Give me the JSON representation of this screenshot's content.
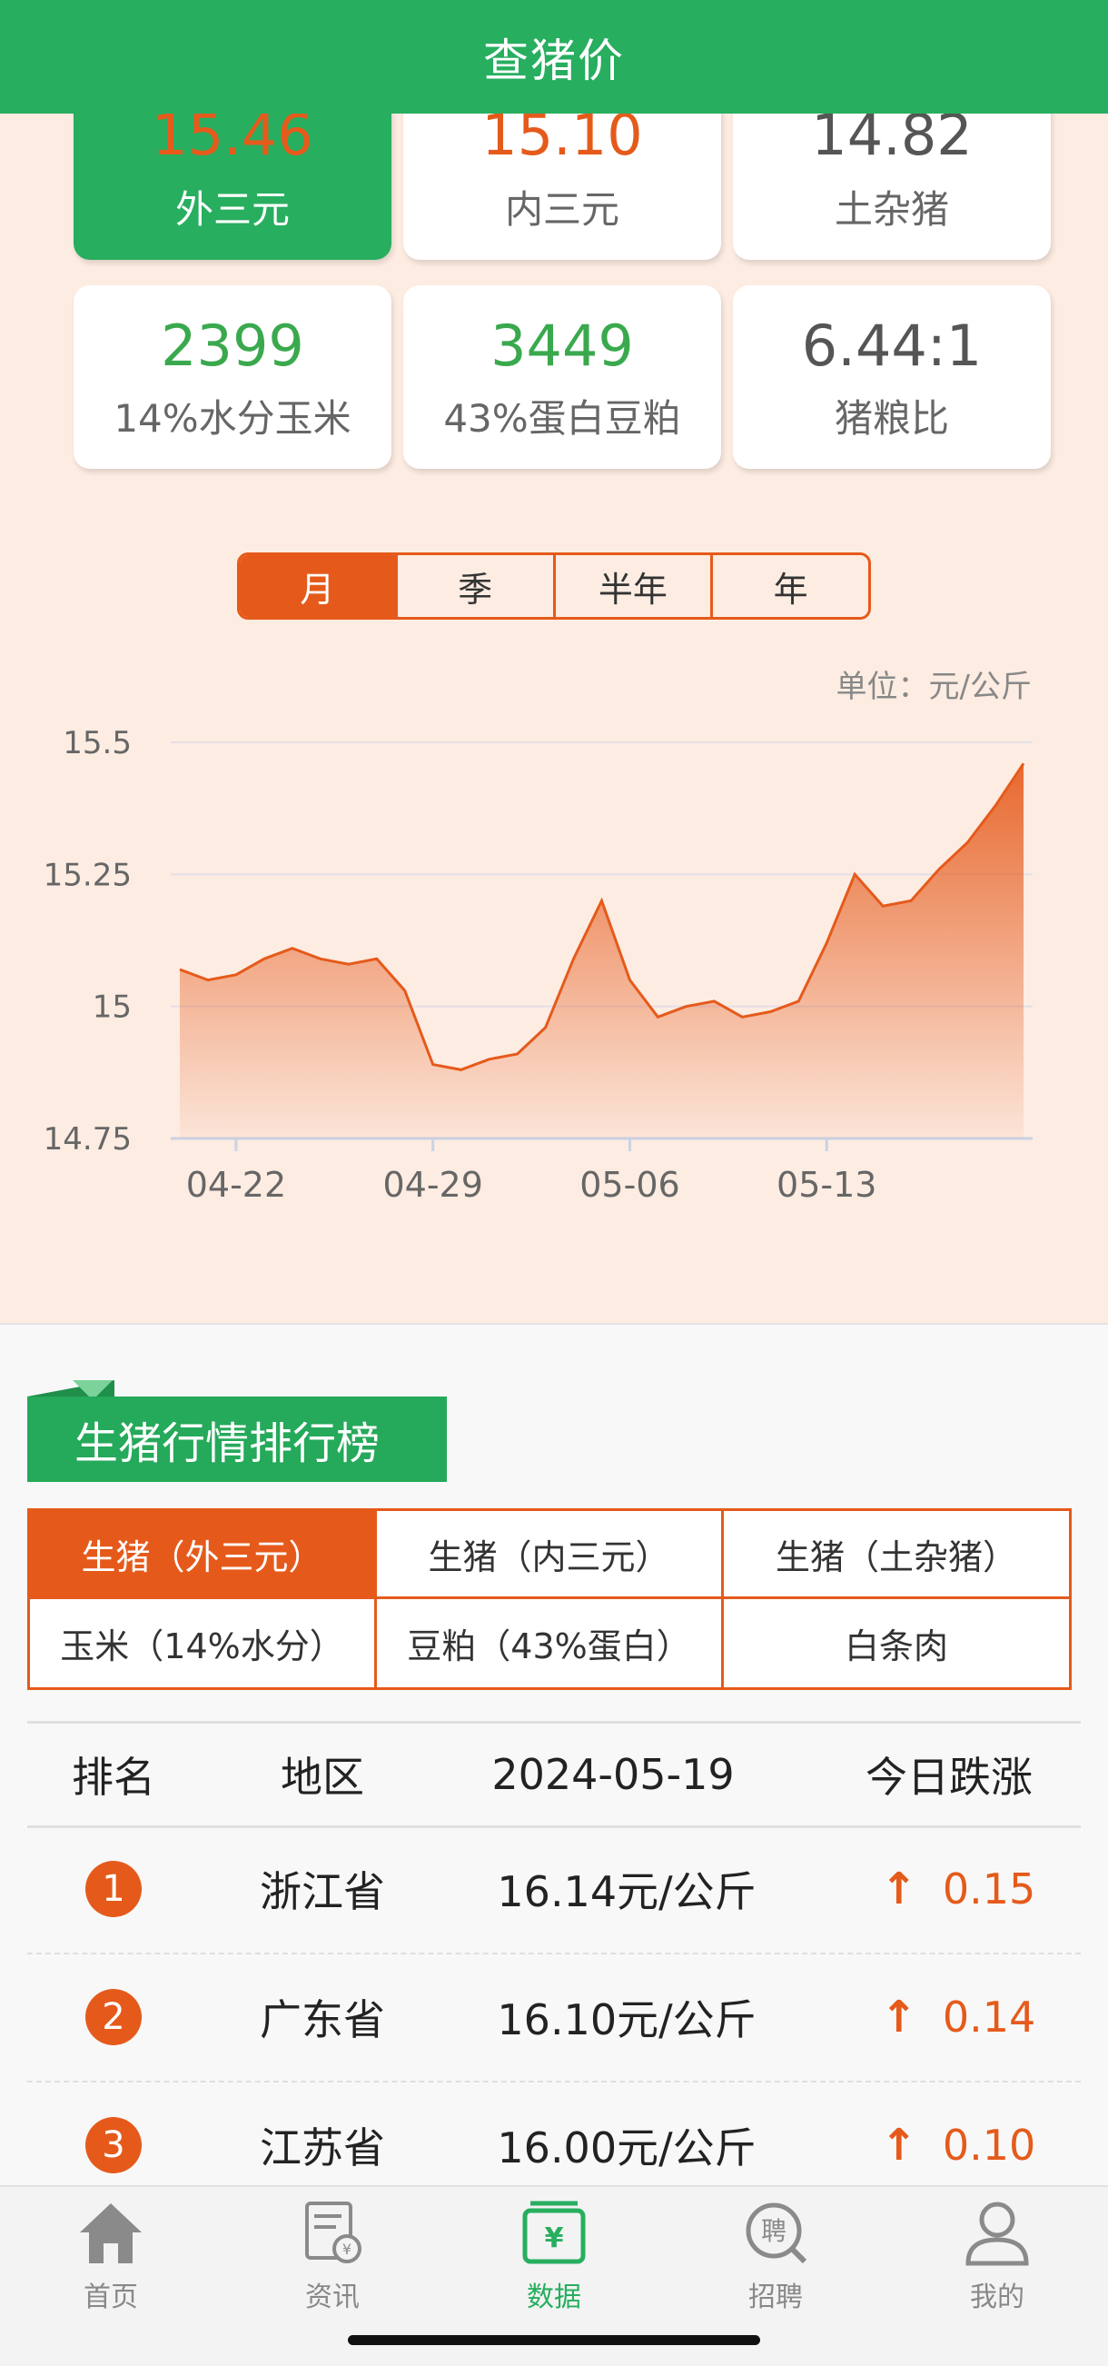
{
  "header": {
    "title": "查猪价"
  },
  "cards": [
    {
      "value": "15.46",
      "label": "外三元",
      "color": "#e55a1b",
      "active": true
    },
    {
      "value": "15.10",
      "label": "内三元",
      "color": "#e55a1b",
      "active": false
    },
    {
      "value": "14.82",
      "label": "土杂猪",
      "color": "#555555",
      "active": false
    },
    {
      "value": "2399",
      "label": "14%水分玉米",
      "color": "#3aa94e",
      "active": false
    },
    {
      "value": "3449",
      "label": "43%蛋白豆粕",
      "color": "#3aa94e",
      "active": false
    },
    {
      "value": "6.44:1",
      "label": "猪粮比",
      "color": "#555555",
      "active": false
    }
  ],
  "period_tabs": [
    "月",
    "季",
    "半年",
    "年"
  ],
  "period_active": "月",
  "unit": "单位：元/公斤",
  "chart_data": {
    "type": "area",
    "x": [
      "04-20",
      "04-21",
      "04-22",
      "04-23",
      "04-24",
      "04-25",
      "04-26",
      "04-27",
      "04-28",
      "04-29",
      "04-30",
      "05-01",
      "05-02",
      "05-03",
      "05-04",
      "05-05",
      "05-06",
      "05-07",
      "05-08",
      "05-09",
      "05-10",
      "05-11",
      "05-12",
      "05-13",
      "05-14",
      "05-15",
      "05-16",
      "05-17",
      "05-18",
      "05-19"
    ],
    "values": [
      15.07,
      15.05,
      15.06,
      15.09,
      15.11,
      15.09,
      15.08,
      15.09,
      15.03,
      14.89,
      14.88,
      14.9,
      14.91,
      14.96,
      15.09,
      15.2,
      15.05,
      14.98,
      15.0,
      15.01,
      14.98,
      14.99,
      15.01,
      15.12,
      15.25,
      15.19,
      15.2,
      15.26,
      15.31,
      15.38,
      15.46
    ],
    "xticks": [
      "04-22",
      "04-29",
      "05-06",
      "05-13"
    ],
    "yticks": [
      "15.5",
      "15.25",
      "15",
      "14.75"
    ],
    "ylim": [
      14.75,
      15.5
    ],
    "grid": true,
    "color": "#e55a1b"
  },
  "ranking": {
    "title": "生猪行情排行榜",
    "categories": [
      "生猪（外三元）",
      "生猪（内三元）",
      "生猪（土杂猪）",
      "玉米（14%水分）",
      "豆粕（43%蛋白）",
      "白条肉"
    ],
    "active_category": "生猪（外三元）",
    "headers": {
      "rank": "排名",
      "region": "地区",
      "date": "2024-05-19",
      "change": "今日跌涨"
    },
    "rows": [
      {
        "rank": "1",
        "region": "浙江省",
        "price": "16.14元/公斤",
        "arrow": "↑",
        "change": "0.15"
      },
      {
        "rank": "2",
        "region": "广东省",
        "price": "16.10元/公斤",
        "arrow": "↑",
        "change": "0.14"
      },
      {
        "rank": "3",
        "region": "江苏省",
        "price": "16.00元/公斤",
        "arrow": "↑",
        "change": "0.10"
      }
    ]
  },
  "bottom_nav": [
    {
      "label": "首页",
      "icon": "home-icon",
      "active": false
    },
    {
      "label": "资讯",
      "icon": "news-icon",
      "active": false
    },
    {
      "label": "数据",
      "icon": "data-icon",
      "active": true
    },
    {
      "label": "招聘",
      "icon": "recruit-icon",
      "active": false
    },
    {
      "label": "我的",
      "icon": "profile-icon",
      "active": false
    }
  ]
}
